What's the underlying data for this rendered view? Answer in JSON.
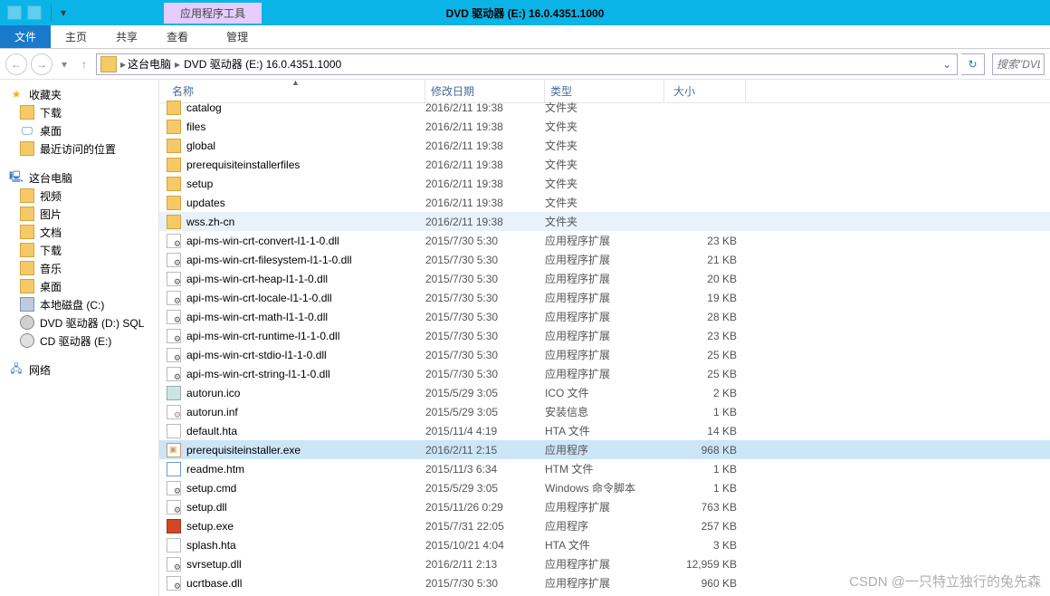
{
  "titlebar": {
    "contextual_label": "应用程序工具",
    "window_title": "DVD 驱动器 (E:) 16.0.4351.1000"
  },
  "ribbon": {
    "file": "文件",
    "tabs": [
      "主页",
      "共享",
      "查看"
    ],
    "ctx_tab": "管理"
  },
  "address": {
    "crumbs": [
      "这台电脑",
      "DVD 驱动器 (E:) 16.0.4351.1000"
    ],
    "search_placeholder": "搜索\"DVD"
  },
  "sidebar": {
    "favorites": {
      "header": "收藏夹",
      "items": [
        "下载",
        "桌面",
        "最近访问的位置"
      ]
    },
    "computer": {
      "header": "这台电脑",
      "items": [
        {
          "label": "视频",
          "icon": "folder-ic"
        },
        {
          "label": "图片",
          "icon": "folder-ic"
        },
        {
          "label": "文档",
          "icon": "folder-ic"
        },
        {
          "label": "下载",
          "icon": "folder-ic"
        },
        {
          "label": "音乐",
          "icon": "folder-ic"
        },
        {
          "label": "桌面",
          "icon": "folder-ic"
        },
        {
          "label": "本地磁盘 (C:)",
          "icon": "disk"
        },
        {
          "label": "DVD 驱动器 (D:) SQL",
          "icon": "dvd-ic"
        },
        {
          "label": "CD 驱动器 (E:)",
          "icon": "cd-ic"
        }
      ]
    },
    "network": {
      "header": "网络"
    }
  },
  "columns": {
    "name": "名称",
    "date": "修改日期",
    "type": "类型",
    "size": "大小"
  },
  "files": [
    {
      "name": "catalog",
      "date": "2016/2/11 19:38",
      "type": "文件夹",
      "size": "",
      "icon": "fi-folder"
    },
    {
      "name": "files",
      "date": "2016/2/11 19:38",
      "type": "文件夹",
      "size": "",
      "icon": "fi-folder"
    },
    {
      "name": "global",
      "date": "2016/2/11 19:38",
      "type": "文件夹",
      "size": "",
      "icon": "fi-folder"
    },
    {
      "name": "prerequisiteinstallerfiles",
      "date": "2016/2/11 19:38",
      "type": "文件夹",
      "size": "",
      "icon": "fi-folder"
    },
    {
      "name": "setup",
      "date": "2016/2/11 19:38",
      "type": "文件夹",
      "size": "",
      "icon": "fi-folder"
    },
    {
      "name": "updates",
      "date": "2016/2/11 19:38",
      "type": "文件夹",
      "size": "",
      "icon": "fi-folder"
    },
    {
      "name": "wss.zh-cn",
      "date": "2016/2/11 19:38",
      "type": "文件夹",
      "size": "",
      "icon": "fi-folder",
      "hover": true
    },
    {
      "name": "api-ms-win-crt-convert-l1-1-0.dll",
      "date": "2015/7/30 5:30",
      "type": "应用程序扩展",
      "size": "23 KB",
      "icon": "fi-dll"
    },
    {
      "name": "api-ms-win-crt-filesystem-l1-1-0.dll",
      "date": "2015/7/30 5:30",
      "type": "应用程序扩展",
      "size": "21 KB",
      "icon": "fi-dll"
    },
    {
      "name": "api-ms-win-crt-heap-l1-1-0.dll",
      "date": "2015/7/30 5:30",
      "type": "应用程序扩展",
      "size": "20 KB",
      "icon": "fi-dll"
    },
    {
      "name": "api-ms-win-crt-locale-l1-1-0.dll",
      "date": "2015/7/30 5:30",
      "type": "应用程序扩展",
      "size": "19 KB",
      "icon": "fi-dll"
    },
    {
      "name": "api-ms-win-crt-math-l1-1-0.dll",
      "date": "2015/7/30 5:30",
      "type": "应用程序扩展",
      "size": "28 KB",
      "icon": "fi-dll"
    },
    {
      "name": "api-ms-win-crt-runtime-l1-1-0.dll",
      "date": "2015/7/30 5:30",
      "type": "应用程序扩展",
      "size": "23 KB",
      "icon": "fi-dll"
    },
    {
      "name": "api-ms-win-crt-stdio-l1-1-0.dll",
      "date": "2015/7/30 5:30",
      "type": "应用程序扩展",
      "size": "25 KB",
      "icon": "fi-dll"
    },
    {
      "name": "api-ms-win-crt-string-l1-1-0.dll",
      "date": "2015/7/30 5:30",
      "type": "应用程序扩展",
      "size": "25 KB",
      "icon": "fi-dll"
    },
    {
      "name": "autorun.ico",
      "date": "2015/5/29 3:05",
      "type": "ICO 文件",
      "size": "2 KB",
      "icon": "fi-ico"
    },
    {
      "name": "autorun.inf",
      "date": "2015/5/29 3:05",
      "type": "安装信息",
      "size": "1 KB",
      "icon": "fi-inf"
    },
    {
      "name": "default.hta",
      "date": "2015/11/4 4:19",
      "type": "HTA 文件",
      "size": "14 KB",
      "icon": "fi-hta"
    },
    {
      "name": "prerequisiteinstaller.exe",
      "date": "2016/2/11 2:15",
      "type": "应用程序",
      "size": "968 KB",
      "icon": "fi-exe",
      "selected": true
    },
    {
      "name": "readme.htm",
      "date": "2015/11/3 6:34",
      "type": "HTM 文件",
      "size": "1 KB",
      "icon": "fi-htm"
    },
    {
      "name": "setup.cmd",
      "date": "2015/5/29 3:05",
      "type": "Windows 命令脚本",
      "size": "1 KB",
      "icon": "fi-cmd"
    },
    {
      "name": "setup.dll",
      "date": "2015/11/26 0:29",
      "type": "应用程序扩展",
      "size": "763 KB",
      "icon": "fi-dll"
    },
    {
      "name": "setup.exe",
      "date": "2015/7/31 22:05",
      "type": "应用程序",
      "size": "257 KB",
      "icon": "fi-setup"
    },
    {
      "name": "splash.hta",
      "date": "2015/10/21 4:04",
      "type": "HTA 文件",
      "size": "3 KB",
      "icon": "fi-hta"
    },
    {
      "name": "svrsetup.dll",
      "date": "2016/2/11 2:13",
      "type": "应用程序扩展",
      "size": "12,959 KB",
      "icon": "fi-dll"
    },
    {
      "name": "ucrtbase.dll",
      "date": "2015/7/30 5:30",
      "type": "应用程序扩展",
      "size": "960 KB",
      "icon": "fi-dll"
    }
  ],
  "watermark": "CSDN @一只特立独行的兔先森"
}
